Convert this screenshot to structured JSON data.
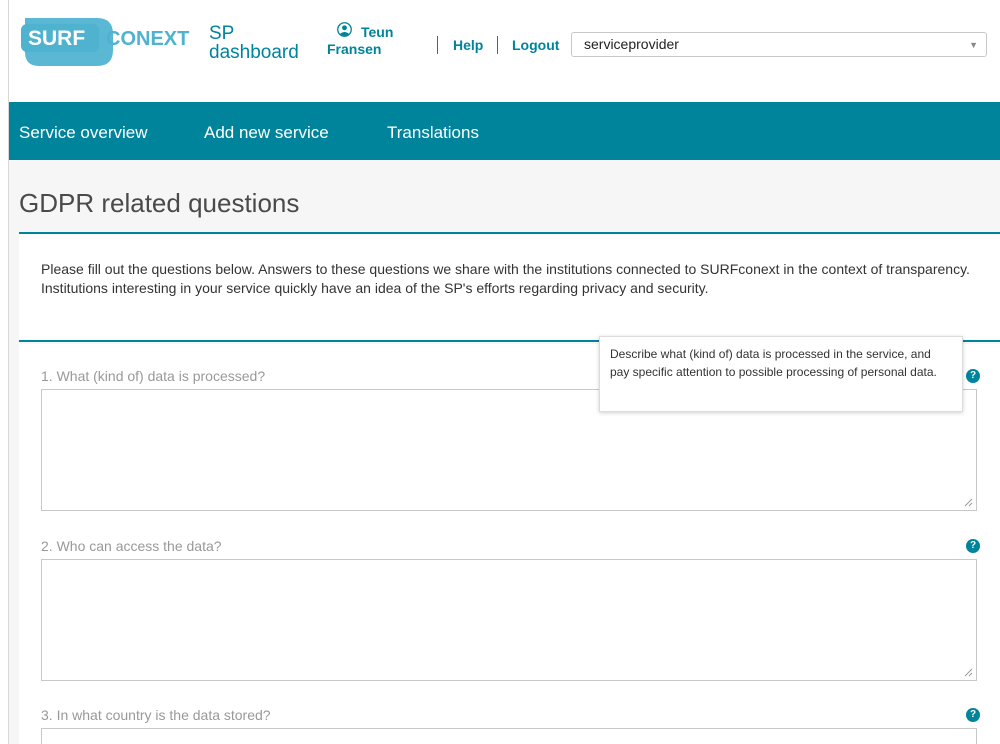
{
  "brand": {
    "logo_word1": "SURF",
    "logo_word2": "CONEXT",
    "app_title_line1": "SP",
    "app_title_line2": "dashboard",
    "accent_color": "#00849c"
  },
  "user": {
    "first_name": "Teun",
    "last_name": "Fransen",
    "icon": "user-circle-icon"
  },
  "header_links": {
    "help": "Help",
    "logout": "Logout"
  },
  "sp_select": {
    "value": "serviceprovider"
  },
  "nav": {
    "items": [
      {
        "label": "Service overview"
      },
      {
        "label": "Add new service"
      },
      {
        "label": "Translations"
      }
    ]
  },
  "page": {
    "title": "GDPR related questions",
    "intro": "Please fill out the questions below. Answers to these questions we share with the institutions connected to SURFconext in the context of transparency. Institutions interesting in your service quickly have an idea of the SP's efforts regarding privacy and security."
  },
  "questions": [
    {
      "label": "1. What (kind of) data is processed?",
      "value": ""
    },
    {
      "label": "2. Who can access the data?",
      "value": ""
    },
    {
      "label": "3. In what country is the data stored?",
      "value": ""
    }
  ],
  "tooltip": {
    "text": "Describe what (kind of) data is processed in the service, and pay specific attention to possible processing of personal data."
  },
  "help_icon_glyph": "?"
}
